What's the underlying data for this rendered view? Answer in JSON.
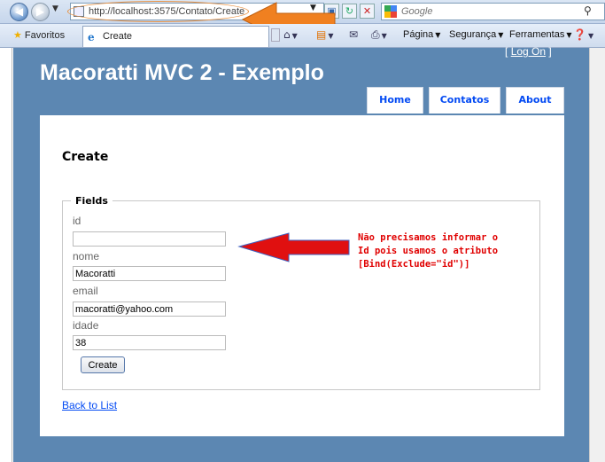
{
  "browser": {
    "address_url": "http://localhost:3575/Contato/Create",
    "search_placeholder": "Google",
    "favorites_label": "Favoritos",
    "tab_title": "Create",
    "commands": {
      "pagina": "Página",
      "seguranca": "Segurança",
      "ferramentas": "Ferramentas"
    },
    "icons": [
      "back-icon",
      "forward-icon",
      "compatibility-icon",
      "refresh-icon",
      "stop-icon",
      "google-icon",
      "search-icon",
      "star-icon",
      "ie-icon",
      "home-icon",
      "feeds-icon",
      "mail-icon",
      "print-icon",
      "help-icon"
    ]
  },
  "site": {
    "logon_open": "[",
    "logon_text": "Log On",
    "logon_close": "]",
    "title": "Macoratti MVC 2 - Exemplo",
    "menu": {
      "home": "Home",
      "contatos": "Contatos",
      "about": "About"
    }
  },
  "form": {
    "page_title": "Create",
    "legend": "Fields",
    "fields": {
      "id": {
        "label": "id",
        "value": ""
      },
      "nome": {
        "label": "nome",
        "value": "Macoratti"
      },
      "email": {
        "label": "email",
        "value": "macoratti@yahoo.com"
      },
      "idade": {
        "label": "idade",
        "value": "38"
      }
    },
    "submit_label": "Create",
    "back_link": "Back to List"
  },
  "annotation": {
    "lines": [
      "Não precisamos informar o",
      "Id pois usamos o atributo",
      "[Bind(Exclude=\"id\")]"
    ],
    "text_color": "#e00000",
    "arrow_color": "#e01010",
    "url_arrow_color": "#f08020"
  }
}
